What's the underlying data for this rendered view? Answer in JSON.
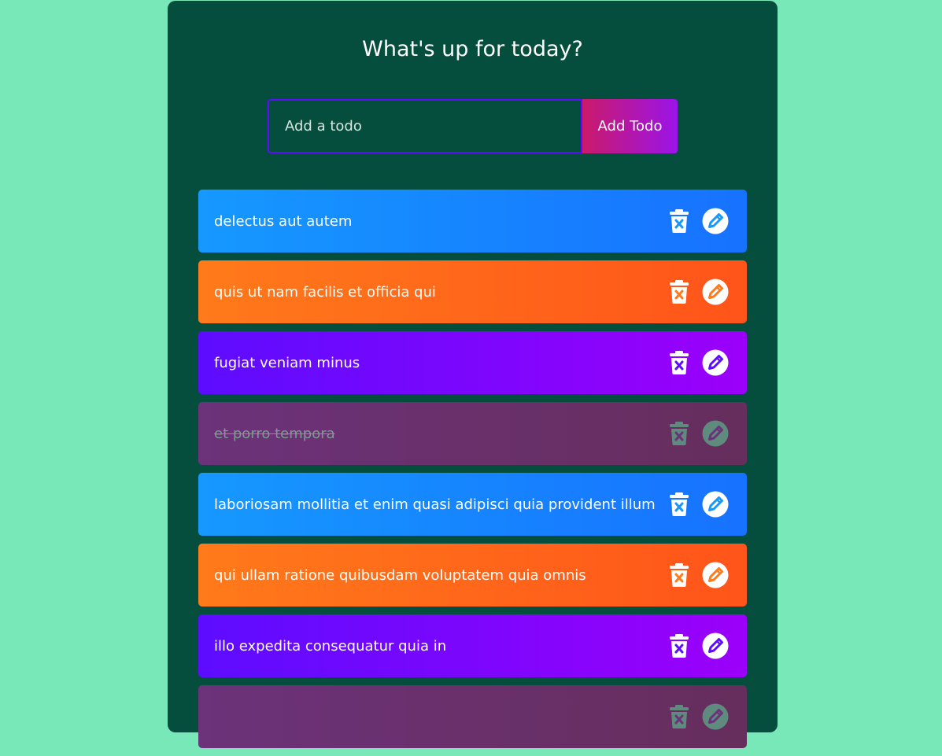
{
  "header": {
    "title": "What's up for today?"
  },
  "form": {
    "input_value": "",
    "input_placeholder": "Add a todo",
    "button_label": "Add Todo"
  },
  "todos": [
    {
      "text": "delectus aut autem",
      "color": "blue",
      "completed": false
    },
    {
      "text": "quis ut nam facilis et officia qui",
      "color": "orange",
      "completed": false
    },
    {
      "text": "fugiat veniam minus",
      "color": "purple",
      "completed": false
    },
    {
      "text": "et porro tempora",
      "color": "done",
      "completed": true
    },
    {
      "text": "laboriosam mollitia et enim quasi adipisci quia provident illum",
      "color": "blue",
      "completed": false
    },
    {
      "text": "qui ullam ratione quibusdam voluptatem quia omnis",
      "color": "orange",
      "completed": false
    },
    {
      "text": "illo expedita consequatur quia in",
      "color": "purple",
      "completed": false
    },
    {
      "text": "",
      "color": "done",
      "completed": true
    }
  ],
  "icons": {
    "delete": "trash-x-icon",
    "edit": "edit-pencil-icon"
  },
  "colors": {
    "page_background": "#78e8b9",
    "app_background": "#054e3e",
    "blue": "#1698ff",
    "orange": "#ff7a1a",
    "purple": "#5d0cff",
    "done": "#6c327a",
    "done_icon": "#5f8b7f"
  }
}
